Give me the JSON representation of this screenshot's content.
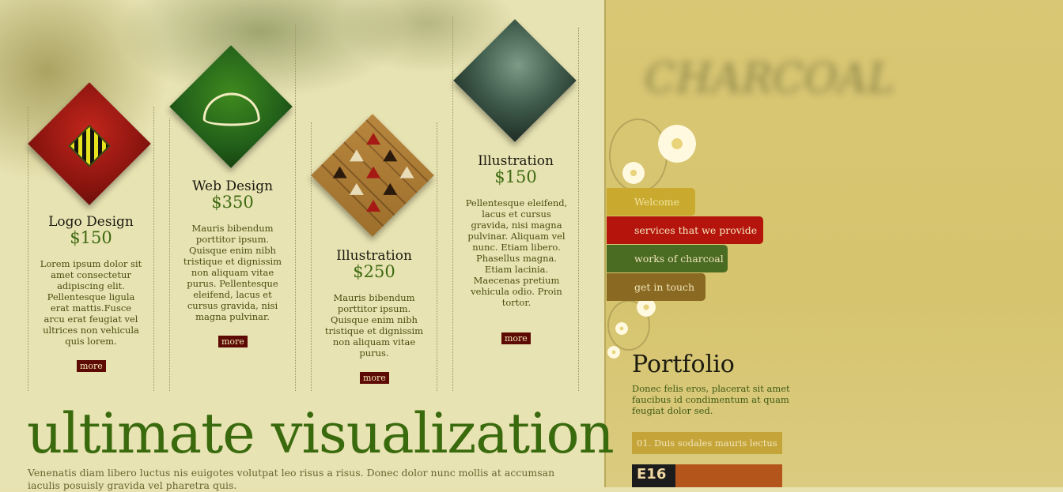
{
  "services": [
    {
      "title": "Logo Design",
      "price": "$150",
      "description": "Lorem ipsum dolor sit amet consectetur adipiscing elit. Pellentesque ligula erat mattis.Fusce arcu erat feugiat vel ultrices non vehicula quis lorem.",
      "more": "more"
    },
    {
      "title": "Web Design",
      "price": "$350",
      "description": "Mauris bibendum porttitor ipsum. Quisque enim nibh tristique et dignissim non aliquam vitae purus. Pellentesque eleifend, lacus et cursus gravida, nisi magna pulvinar.",
      "more": "more"
    },
    {
      "title": "Illustration",
      "price": "$250",
      "description": "Mauris bibendum porttitor ipsum. Quisque enim nibh tristique et dignissim non aliquam vitae purus.",
      "more": "more"
    },
    {
      "title": "Illustration",
      "price": "$150",
      "description": "Pellentesque eleifend, lacus et cursus gravida, nisi magna pulvinar. Aliquam vel nunc. Etiam libero. Phasellus magna. Etiam lacinia. Maecenas pretium vehicula odio. Proin tortor.",
      "more": "more"
    }
  ],
  "headline": "ultimate visualization",
  "body_text": "Venenatis diam libero luctus nis euigotes volutpat leo risus a risus. Donec dolor nunc mollis at accumsan iaculis posuisly gravida vel pharetra quis.",
  "site_logo_text": "CHARCOAL",
  "nav": {
    "welcome": "Welcome",
    "services": "services that we provide",
    "works": "works of charcoal",
    "contact": "get in touch"
  },
  "portfolio": {
    "title": "Portfolio",
    "description": "Donec felis eros, placerat sit amet faucibus id condimentum at quam feugiat dolor sed.",
    "items": [
      "01. Duis sodales mauris lectus"
    ],
    "thumb_label": "E16"
  },
  "colors": {
    "accent_green": "#3a6a0e",
    "accent_red": "#b4140b",
    "button_dark_red": "#5d0a05",
    "panel_gold": "#d9c775"
  }
}
